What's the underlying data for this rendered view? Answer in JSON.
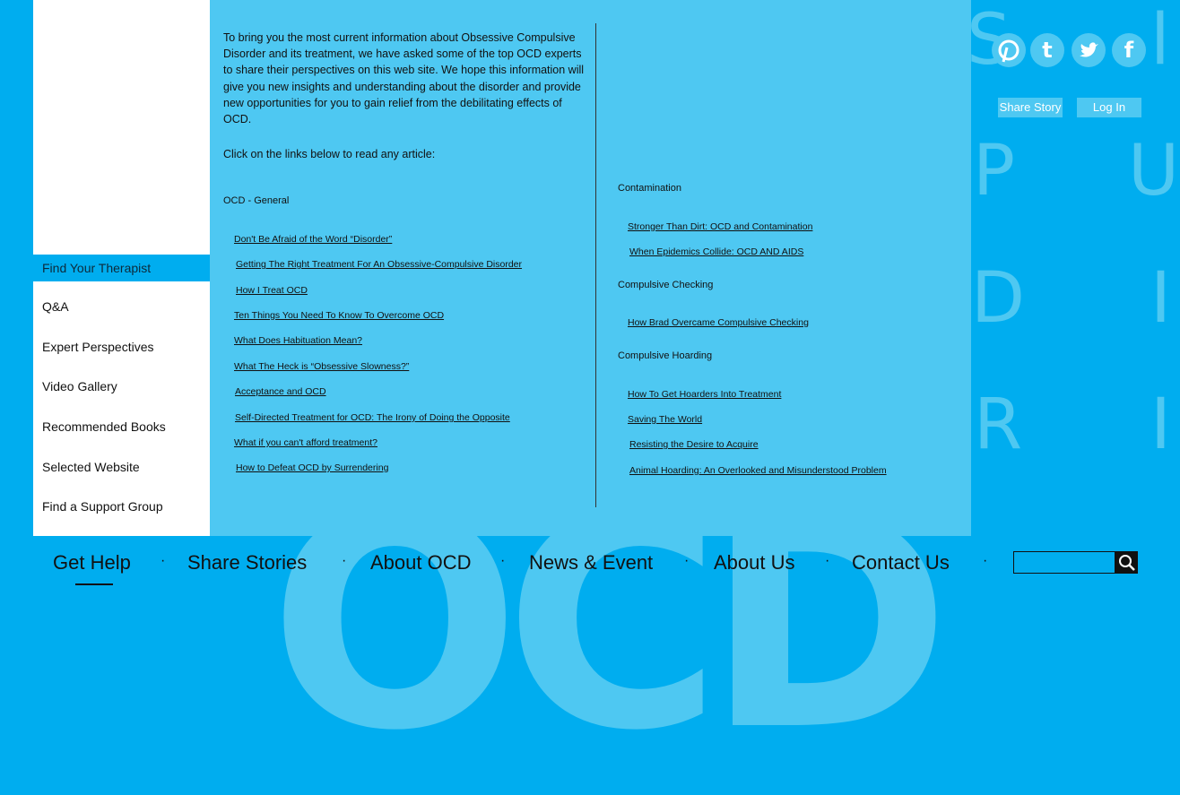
{
  "background_text": "OCD",
  "deco_letters": {
    "s": "S",
    "l": "l",
    "p": "P",
    "u": "U",
    "d": "D",
    "i1": "I",
    "r": "R",
    "i2": "I"
  },
  "colors": {
    "page_bg": "#00adef",
    "panel_bg": "#4ec8f2",
    "sidebar_bg": "#ffffff",
    "active_item": "#00adef"
  },
  "social_icons": [
    "pinterest-icon",
    "tumblr-icon",
    "twitter-icon",
    "facebook-icon"
  ],
  "header_buttons": {
    "share_story": "Share Story",
    "log_in": "Log In"
  },
  "sidebar": {
    "items": [
      {
        "label": "Find Your Therapist",
        "active": true
      },
      {
        "label": "Q&A"
      },
      {
        "label": "Expert Perspectives"
      },
      {
        "label": "Video Gallery"
      },
      {
        "label": "Recommended Books"
      },
      {
        "label": "Selected Website"
      },
      {
        "label": "Find a Support Group"
      }
    ]
  },
  "main": {
    "intro": "To bring you the most current information about Obsessive Compulsive Disorder and its treatment, we have asked some of the top OCD experts to share their perspectives on this web site. We hope this information will give you new insights and understanding about the disorder and provide new opportunities for you to gain relief from the debilitating effects of OCD.",
    "click_text": "Click on the links below to read any article:",
    "left_section": {
      "heading": "OCD - General",
      "links": [
        "Don't Be Afraid of the Word “Disorder”",
        "Getting The Right Treatment For An Obsessive-Compulsive Disorder",
        "How I Treat OCD",
        "Ten Things You Need To Know To Overcome OCD",
        "What Does Habituation Mean?",
        "What The Heck is “Obsessive Slowness?”",
        "Acceptance and OCD",
        "Self-Directed Treatment for OCD: The Irony of Doing the Opposite",
        "What if you can't afford treatment?",
        "How to Defeat OCD by Surrendering"
      ]
    },
    "right_sections": [
      {
        "heading": "Contamination",
        "links": [
          "Stronger Than Dirt: OCD and Contamination",
          "When Epidemics Collide: OCD AND AIDS"
        ]
      },
      {
        "heading": "Compulsive Checking",
        "links": [
          "How Brad Overcame Compulsive Checking"
        ]
      },
      {
        "heading": "Compulsive Hoarding",
        "links": [
          "How To Get Hoarders Into Treatment",
          "Saving The World",
          "Resisting the Desire to Acquire",
          "Animal Hoarding:  An Overlooked and Misunderstood Problem"
        ]
      }
    ]
  },
  "nav": {
    "items": [
      "Get Help",
      "Share Stories",
      "About OCD",
      "News & Event",
      "About Us",
      "Contact Us"
    ],
    "separator": "·",
    "active": "Get Help"
  },
  "search": {
    "placeholder": "",
    "icon": "search-icon"
  }
}
